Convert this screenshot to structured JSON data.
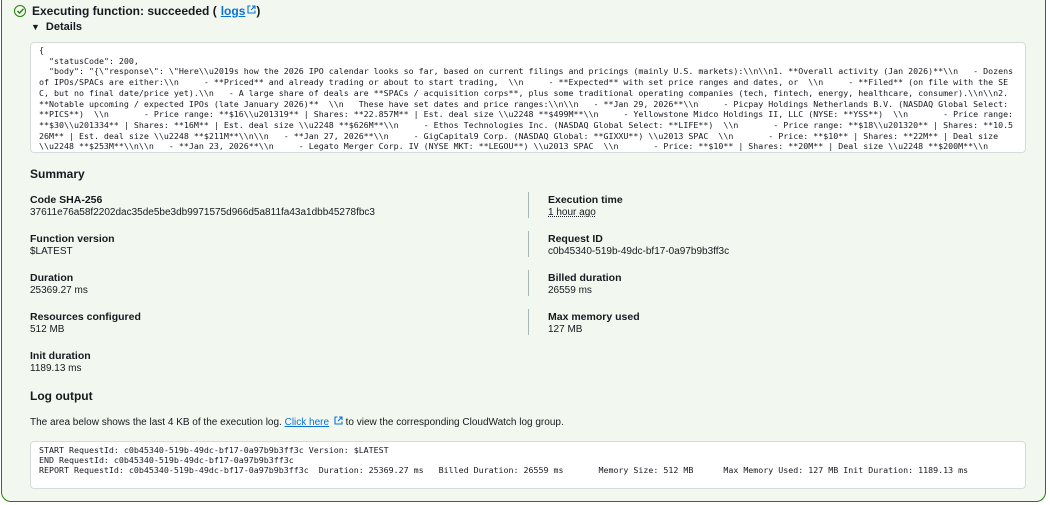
{
  "header": {
    "status_text": "Executing function: succeeded (",
    "logs_link": "logs",
    "close_paren": ")"
  },
  "details_label": "Details",
  "response_json": "{\n  \"statusCode\": 200,\n  \"body\": \"{\\\"response\\\": \\\"Here\\\\u2019s how the 2026 IPO calendar looks so far, based on current filings and pricings (mainly U.S. markets):\\\\n\\\\n1. **Overall activity (Jan 2026)**\\\\n   - Dozens of IPOs/SPACs are either:\\\\n     - **Priced** and already trading or about to start trading,  \\\\n     - **Expected** with set price ranges and dates, or  \\\\n     - **Filed** (on file with the SEC, but no final date/price yet).\\\\n   - A large share of deals are **SPACs / acquisition corps**, plus some traditional operating companies (tech, fintech, energy, healthcare, consumer).\\\\n\\\\n2. **Notable upcoming / expected IPOs (late January 2026)**  \\\\n   These have set dates and price ranges:\\\\n\\\\n   - **Jan 29, 2026**\\\\n     - Picpay Holdings Netherlands B.V. (NASDAQ Global Select: **PICS**)  \\\\n       - Price range: **$16\\\\u201319** | Shares: **22.857M** | Est. deal size \\\\u2248 **$499M**\\\\n     - Yellowstone Midco Holdings II, LLC (NYSE: **YSS**)  \\\\n       - Price range: **$30\\\\u201334** | Shares: **16M** | Est. deal size \\\\u2248 **$626M**\\\\n     - Ethos Technologies Inc. (NASDAQ Global Select: **LIFE**)  \\\\n       - Price range: **$18\\\\u201320** | Shares: **10.526M** | Est. deal size \\\\u2248 **$211M**\\\\n\\\\n   - **Jan 27, 2026**\\\\n     - GigCapital9 Corp. (NASDAQ Global: **GIXXU**) \\\\u2013 SPAC  \\\\n       - Price: **$10** | Shares: **22M** | Deal size \\\\u2248 **$253M**\\\\n\\\\n   - **Jan 23, 2026**\\\\n     - Legato Merger Corp. IV (NYSE MKT: **LEGOU**) \\\\u2013 SPAC  \\\\n       - Price: **$10** | Shares: **20M** | Deal size \\\\u2248 **$200M**\\\\n     - Praetorian Acquisition Corp. (NASDAQ Global: **PTORU**) \\\\u2013 SPAC  \\\\n       - Price:",
  "summary": {
    "title": "Summary",
    "fields": {
      "code_sha": {
        "label": "Code SHA-256",
        "value": "37611e76a58f2202dac35de5be3db9971575d966d5a811fa43a1dbb45278fbc3"
      },
      "execution_time": {
        "label": "Execution time",
        "value": "1 hour ago"
      },
      "function_version": {
        "label": "Function version",
        "value": "$LATEST"
      },
      "request_id": {
        "label": "Request ID",
        "value": "c0b45340-519b-49dc-bf17-0a97b9b3ff3c"
      },
      "duration": {
        "label": "Duration",
        "value": "25369.27 ms"
      },
      "billed_duration": {
        "label": "Billed duration",
        "value": "26559 ms"
      },
      "resources": {
        "label": "Resources configured",
        "value": "512 MB"
      },
      "max_memory": {
        "label": "Max memory used",
        "value": "127 MB"
      },
      "init_duration": {
        "label": "Init duration",
        "value": "1189.13 ms"
      }
    }
  },
  "log_output": {
    "title": "Log output",
    "desc_before": "The area below shows the last 4 KB of the execution log. ",
    "link": "Click here",
    "desc_after": " to view the corresponding CloudWatch log group.",
    "text": "START RequestId: c0b45340-519b-49dc-bf17-0a97b9b3ff3c Version: $LATEST\nEND RequestId: c0b45340-519b-49dc-bf17-0a97b9b3ff3c\nREPORT RequestId: c0b45340-519b-49dc-bf17-0a97b9b3ff3c  Duration: 25369.27 ms   Billed Duration: 26559 ms       Memory Size: 512 MB      Max Memory Used: 127 MB Init Duration: 1189.13 ms"
  },
  "colors": {
    "success": "#1d8102",
    "link": "#0972d3",
    "panel_bg": "#f2f8f0"
  },
  "icons": {
    "status": "check-circle-icon",
    "external": "external-link-icon",
    "details": "caret-down-icon"
  }
}
